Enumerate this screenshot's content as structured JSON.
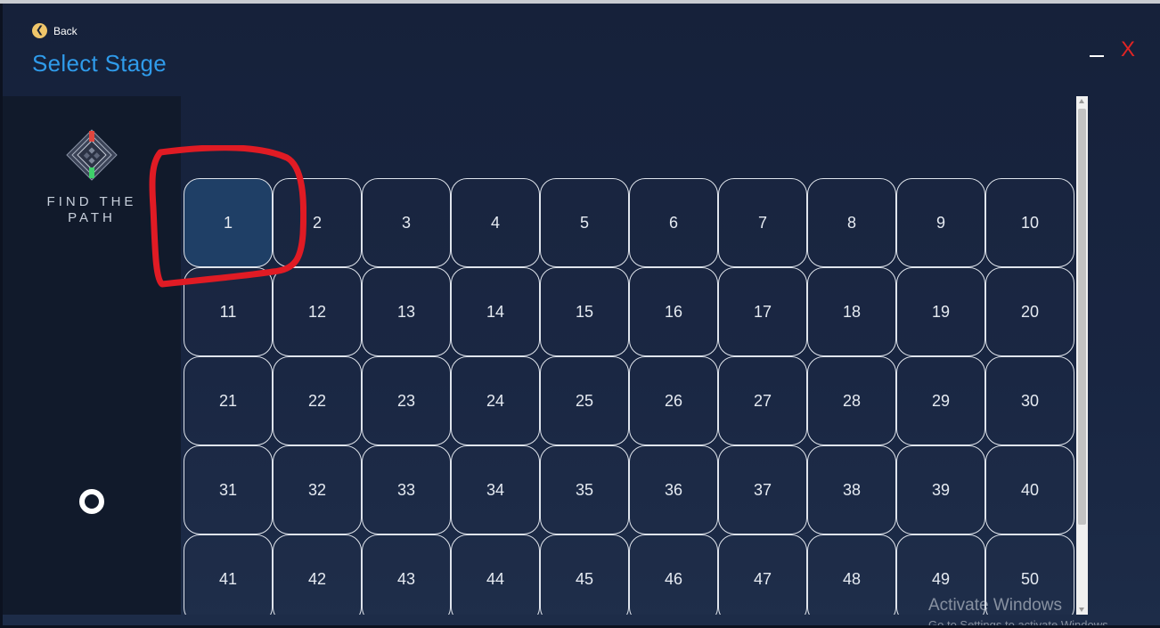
{
  "header": {
    "back_label": "Back",
    "title": "Select Stage",
    "close_label": "X"
  },
  "sidebar": {
    "logo_text_line1": "FIND THE",
    "logo_text_line2": "PATH"
  },
  "stages": {
    "selected": "1",
    "items": [
      "1",
      "2",
      "3",
      "4",
      "5",
      "6",
      "7",
      "8",
      "9",
      "10",
      "11",
      "12",
      "13",
      "14",
      "15",
      "16",
      "17",
      "18",
      "19",
      "20",
      "21",
      "22",
      "23",
      "24",
      "25",
      "26",
      "27",
      "28",
      "29",
      "30",
      "31",
      "32",
      "33",
      "34",
      "35",
      "36",
      "37",
      "38",
      "39",
      "40",
      "41",
      "42",
      "43",
      "44",
      "45",
      "46",
      "47",
      "48",
      "49",
      "50"
    ]
  },
  "watermark": {
    "title": "Activate Windows",
    "subtitle": "Go to Settings to activate Windows."
  },
  "colors": {
    "title": "#2f9bea",
    "close": "#e02424",
    "back_icon": "#f0c66a",
    "selected_tile": "#1f3f66",
    "annotation": "#e01b24"
  }
}
